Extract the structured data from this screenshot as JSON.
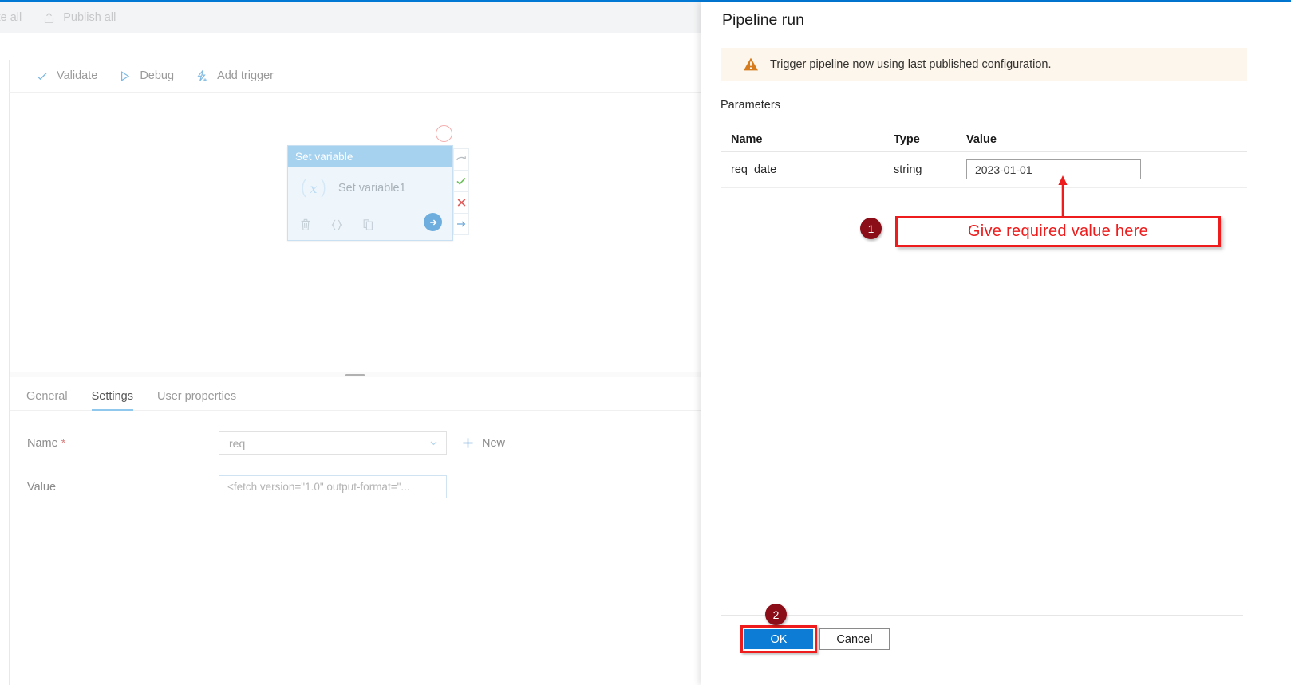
{
  "theme": {
    "accent_blue": "#0078d4",
    "node_header_blue": "#a6d2ef",
    "warning_orange": "#d67c1c",
    "annotation_red": "#ee1c1c",
    "badge_dark_red": "#8b0d18",
    "ok_button_blue": "#0c7cd5"
  },
  "command_bar": {
    "validate_all_label": "lidate all",
    "publish_all_label": "Publish all"
  },
  "toolbar": {
    "validate_label": "Validate",
    "debug_label": "Debug",
    "add_trigger_label": "Add trigger"
  },
  "canvas": {
    "node": {
      "header_label": "Set variable",
      "title": "Set variable1",
      "actions": {
        "delete_label": "Ὕ1",
        "code_label": "{ }",
        "clone_label": "❐",
        "run_label": "→"
      }
    },
    "side_rail": [
      "↷",
      "✓",
      "✕",
      "→"
    ]
  },
  "properties": {
    "tabs": [
      {
        "label": "General",
        "active": false
      },
      {
        "label": "Settings",
        "active": true
      },
      {
        "label": "User properties",
        "active": false
      }
    ],
    "name_field": {
      "label": "Name",
      "required_marker": "*",
      "value": "req"
    },
    "value_field": {
      "label": "Value",
      "value": "<fetch version=\"1.0\" output-format=\"..."
    },
    "new_button_label": "New"
  },
  "pipeline_run": {
    "title": "Pipeline run",
    "warning": "Trigger pipeline now using last published configuration.",
    "parameters_heading": "Parameters",
    "table": {
      "columns": [
        "Name",
        "Type",
        "Value"
      ],
      "rows": [
        {
          "name": "req_date",
          "type": "string",
          "value": "2023-01-01"
        }
      ]
    },
    "ok_label": "OK",
    "cancel_label": "Cancel"
  },
  "annotations": {
    "badge_1": "1",
    "badge_2": "2",
    "callout_text": "Give required value here"
  }
}
